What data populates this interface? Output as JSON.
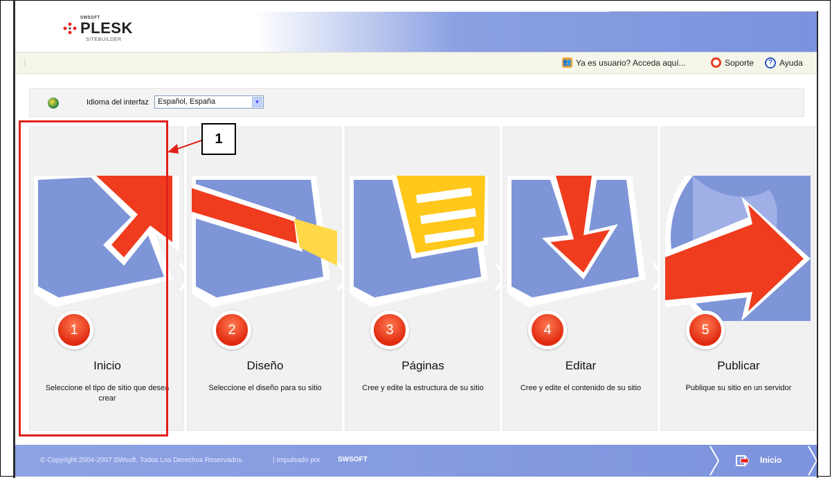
{
  "brand": {
    "vendor": "SWSOFT",
    "product": "PLESK",
    "subtitle": "SITEBUILDER"
  },
  "toolbar": {
    "login_label": "Ya es usuario? Acceda aquí...",
    "support_label": "Soporte",
    "help_label": "Ayuda"
  },
  "language": {
    "label": "Idioma del interfaz",
    "selected": "Español, España"
  },
  "steps": [
    {
      "number": "1",
      "title": "Inicio",
      "description": "Seleccione el tipo de sitio que desea crear"
    },
    {
      "number": "2",
      "title": "Diseño",
      "description": "Seleccione el diseño para su sitio"
    },
    {
      "number": "3",
      "title": "Páginas",
      "description": "Cree y edite la estructura de su sitio"
    },
    {
      "number": "4",
      "title": "Editar",
      "description": "Cree y edite el contenido de su sitio"
    },
    {
      "number": "5",
      "title": "Publicar",
      "description": "Publique su sitio en un servidor"
    }
  ],
  "footer": {
    "copyright": "© Copyright 2004-2007 SWsoft. Todos Los Derechos Reservados.",
    "powered_by": "| Impulsado por",
    "powered_brand": "SWSOFT",
    "start_button": "Inicio"
  },
  "annotation": {
    "callout_number": "1"
  },
  "colors": {
    "accent_blue": "#7b92de",
    "step_red": "#e02a10",
    "highlight_red": "#e0201a"
  }
}
